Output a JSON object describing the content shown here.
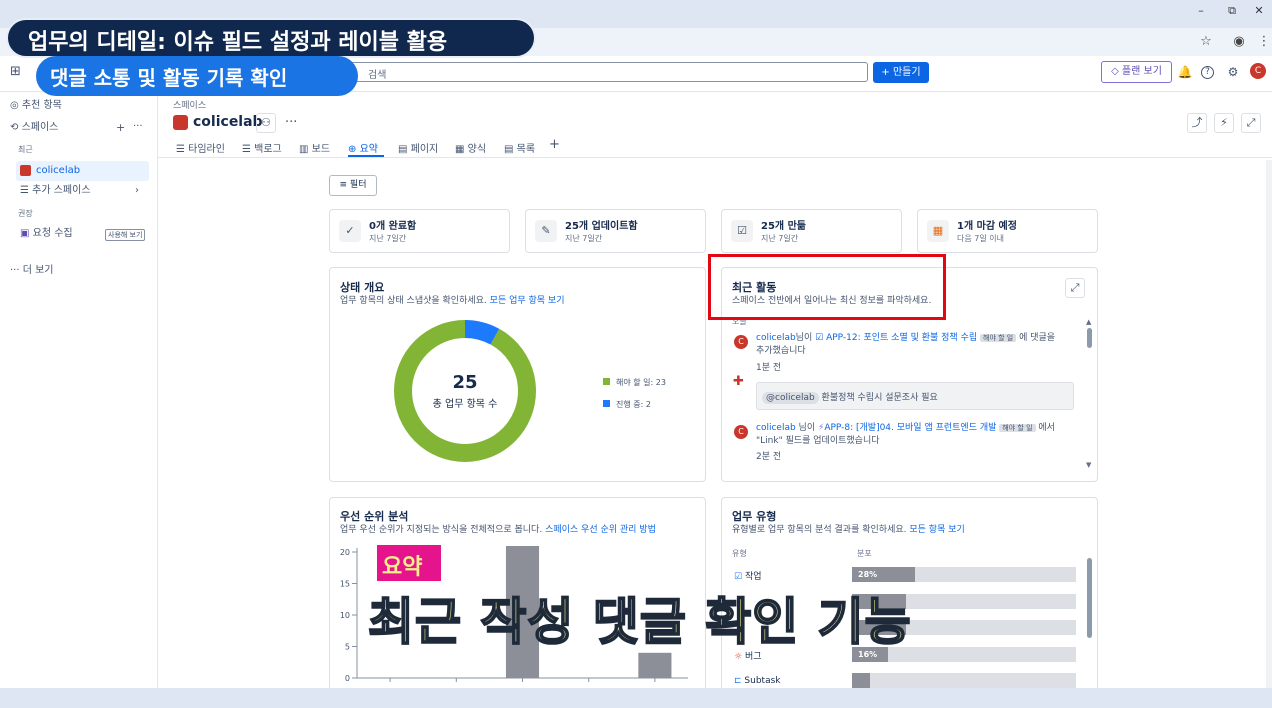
{
  "browser": {
    "minimize": "–",
    "maximize": "⧉",
    "close": "✕",
    "star_icon": "☆",
    "account_icon": "◉",
    "menu_icon": "⋮"
  },
  "topbar": {
    "apps_icon": "⊞",
    "search_placeholder": "검색",
    "search_icon": "⌕",
    "create_label": "+ 만들기",
    "plan_label": "◇ 플랜 보기",
    "bell_icon": "🔔",
    "help_icon": "?",
    "settings_icon": "⚙",
    "avatar_initial": "C"
  },
  "sidebar": {
    "recommended": "추천 항목",
    "spaces": "스페이스",
    "recent_header": "최근",
    "active_space": "colicelab",
    "more_spaces": "추가 스페이스",
    "recommended_header": "권장",
    "request_collect": "요청 수집",
    "try_badge": "사용해 보기",
    "more": "더 보기"
  },
  "header": {
    "breadcrumb": "스페이스",
    "title": "colicelab",
    "tabs": [
      "타임라인",
      "백로그",
      "보드",
      "요약",
      "페이지",
      "양식",
      "목록"
    ],
    "filter": "필터"
  },
  "stats": [
    {
      "title": "0개 완료함",
      "sub": "지난 7일간",
      "icon": "✓"
    },
    {
      "title": "25개 업데이트함",
      "sub": "지난 7일간",
      "icon": "✎"
    },
    {
      "title": "25개 만듦",
      "sub": "지난 7일간",
      "icon": "☑"
    },
    {
      "title": "1개 마감 예정",
      "sub": "다음 7일 이내",
      "icon": "▦"
    }
  ],
  "status": {
    "title": "상태 개요",
    "subtitle": "업무 항목의 상태 스냅샷을 확인하세요.",
    "link": "모든 업무 항목 보기",
    "total": "25",
    "total_label": "총 업무 항목 수",
    "todo_label": "해야 할 일: 23",
    "inprogress_label": "진행 중: 2",
    "todo_value": 23,
    "inprogress_value": 2,
    "todo_color": "#82b536",
    "inprogress_color": "#1d7afc"
  },
  "activity": {
    "title": "최근 활동",
    "subtitle": "스페이스 전반에서 일어나는 최신 정보를 파악하세요.",
    "today": "오늘",
    "item1_user": "colicelab",
    "item1_mid": "님이",
    "item1_issue": "APP-12: 포인트 소멸 및 환불 정책 수립",
    "item1_lozenge": "해야 할 일",
    "item1_suffix": "에 댓글을",
    "item1_line2": "추가했습니다",
    "item1_time": "1분 전",
    "comment_mention": "@colicelab",
    "comment_text": "환불정책 수립시 설문조사 필요",
    "item2_user": "colicelab",
    "item2_mid": "님이",
    "item2_issue": "APP-8: [개발]04. 모바일 앱 프런트엔드 개발",
    "item2_lozenge": "해야 할 일",
    "item2_suffix": "에서",
    "item2_line2": "\"Link\" 필드를 업데이트했습니다",
    "item2_time": "2분 전"
  },
  "priority": {
    "title": "우선 순위 분석",
    "subtitle": "업무 우선 순위가 지정되는 방식을 전체적으로 봅니다.",
    "link": "스페이스 우선 순위 관리 방법"
  },
  "chart_data": {
    "type": "bar",
    "categories": [
      "",
      "",
      "",
      "",
      ""
    ],
    "values": [
      0,
      0,
      21,
      0,
      4
    ],
    "ylim": [
      0,
      20
    ],
    "yticks": [
      "20",
      "15",
      "10",
      "5",
      "0"
    ]
  },
  "worktype": {
    "title": "업무 유형",
    "subtitle": "유형별로 업무 항목의 분석 결과를 확인하세요.",
    "link": "모든 항목 보기",
    "col_type": "유형",
    "col_dist": "분포",
    "rows": [
      {
        "label": "작업",
        "pct": "28%",
        "value": 28
      },
      {
        "label": "",
        "pct": "",
        "value": 24
      },
      {
        "label": "",
        "pct": "",
        "value": 24
      },
      {
        "label": "버그",
        "pct": "16%",
        "value": 16
      },
      {
        "label": "Subtask",
        "pct": "",
        "value": 8
      }
    ]
  },
  "overlay": {
    "title": "업무의 디테일: 이슈 필드 설정과 레이블 활용",
    "subtitle": "댓글 소통 및 활동 기록 확인",
    "label": "요약",
    "caption": "최근 작성 댓글 확인 기능"
  }
}
